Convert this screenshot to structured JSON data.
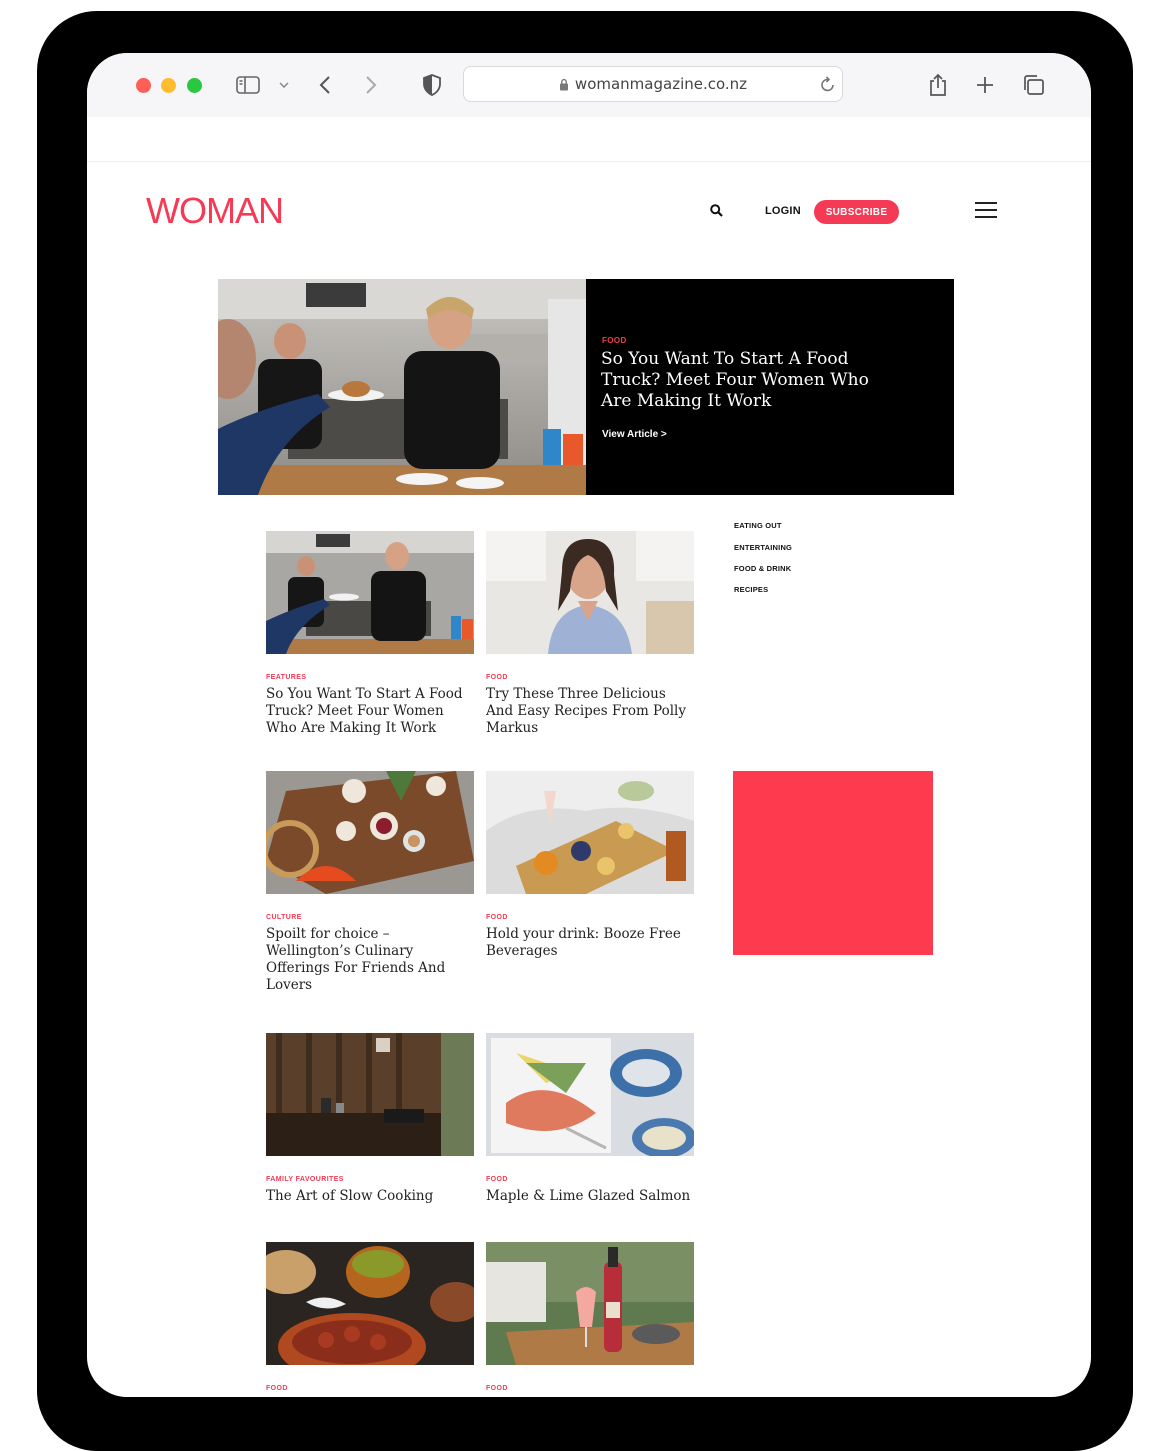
{
  "browser": {
    "url": "womanmagazine.co.nz"
  },
  "site": {
    "logo": "WOMAN",
    "login_label": "LOGIN",
    "subscribe_label": "SUBSCRIBE"
  },
  "hero": {
    "category": "FOOD",
    "title": "So You Want To Start A Food Truck? Meet Four Women Who Are Making It Work",
    "link": "View Article >"
  },
  "sidebar": {
    "items": [
      {
        "label": "EATING OUT"
      },
      {
        "label": "ENTERTAINING"
      },
      {
        "label": "FOOD & DRINK"
      },
      {
        "label": "RECIPES"
      }
    ]
  },
  "articles": [
    {
      "category": "FEATURES",
      "title": "So You Want To Start A Food Truck? Meet Four Women Who Are Making It Work"
    },
    {
      "category": "FOOD",
      "title": "Try These Three Delicious And Easy Recipes From Polly Markus"
    },
    {
      "category": "CULTURE",
      "title": "Spoilt for choice – Wellington’s Culinary Offerings For Friends And Lovers"
    },
    {
      "category": "FOOD",
      "title": "Hold your drink: Booze Free Beverages"
    },
    {
      "category": "FAMILY FAVOURITES",
      "title": "The Art of Slow Cooking"
    },
    {
      "category": "FOOD",
      "title": "Maple & Lime Glazed Salmon"
    },
    {
      "category": "FOOD",
      "title": ""
    },
    {
      "category": "FOOD",
      "title": ""
    }
  ],
  "colors": {
    "brand": "#f43a54",
    "ad_block": "#fe3a4f"
  }
}
